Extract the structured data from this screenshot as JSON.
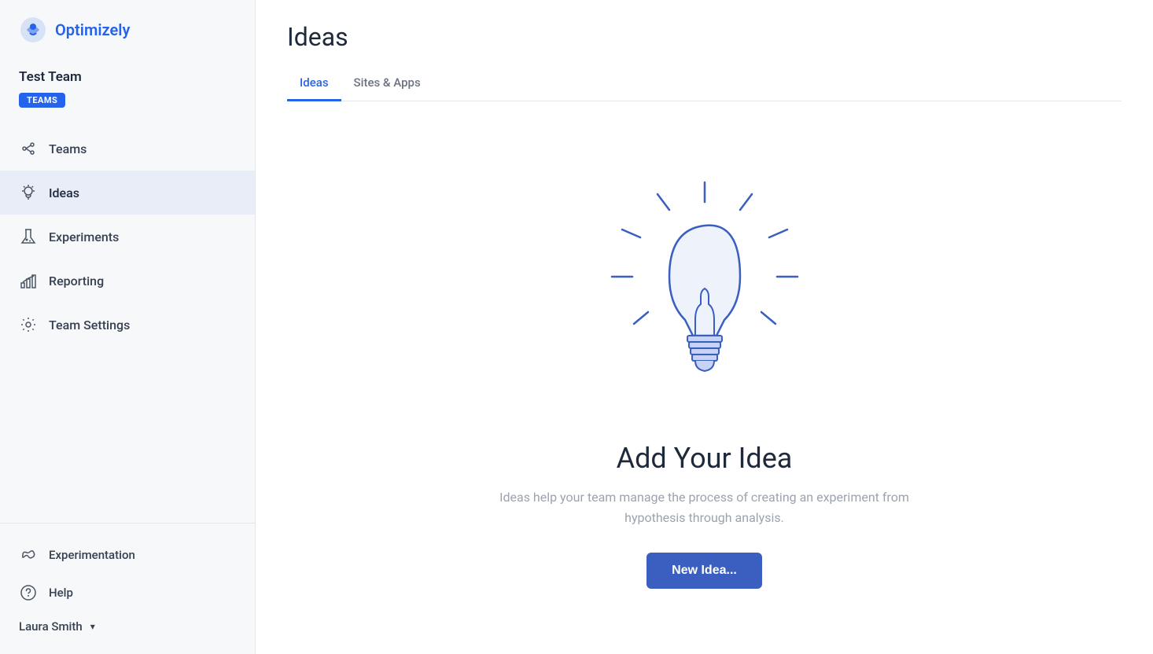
{
  "app": {
    "logo_text": "Optimizely"
  },
  "sidebar": {
    "team_name": "Test Team",
    "teams_badge": "TEAMS",
    "nav_items": [
      {
        "id": "teams",
        "label": "Teams",
        "icon": "teams-icon"
      },
      {
        "id": "ideas",
        "label": "Ideas",
        "icon": "ideas-icon",
        "active": true
      },
      {
        "id": "experiments",
        "label": "Experiments",
        "icon": "experiments-icon"
      },
      {
        "id": "reporting",
        "label": "Reporting",
        "icon": "reporting-icon"
      },
      {
        "id": "team-settings",
        "label": "Team Settings",
        "icon": "settings-icon"
      }
    ],
    "bottom_items": [
      {
        "id": "experimentation",
        "label": "Experimentation",
        "icon": "experimentation-icon"
      },
      {
        "id": "help",
        "label": "Help",
        "icon": "help-icon"
      }
    ],
    "user": {
      "name": "Laura Smith",
      "icon": "user-icon"
    }
  },
  "main": {
    "page_title": "Ideas",
    "tabs": [
      {
        "id": "ideas-tab",
        "label": "Ideas",
        "active": true
      },
      {
        "id": "sites-apps-tab",
        "label": "Sites & Apps",
        "active": false
      }
    ],
    "empty_state": {
      "title": "Add Your Idea",
      "description": "Ideas help your team manage the process of creating an experiment from hypothesis through analysis.",
      "button_label": "New Idea..."
    }
  }
}
